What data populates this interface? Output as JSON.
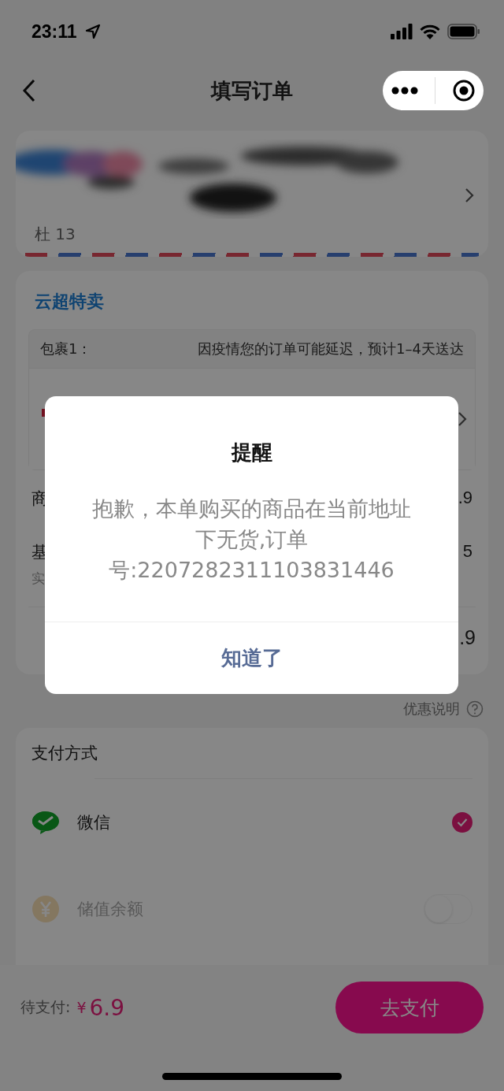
{
  "status_bar": {
    "time": "23:11"
  },
  "nav": {
    "title": "填写订单"
  },
  "address": {
    "name_line": "杜 13"
  },
  "store": {
    "name": "云超特卖",
    "package_label": "包裹1：",
    "package_note": "因疫情您的订单可能延迟，预计1–4天送达",
    "rows": [
      {
        "label": "商",
        "value": ".9"
      },
      {
        "label": "基",
        "sub": "实",
        "value": "5"
      }
    ],
    "total": ".9"
  },
  "discount_note": "优惠说明",
  "payment": {
    "title": "支付方式",
    "methods": [
      {
        "name": "微信",
        "kind": "radio",
        "selected": true
      },
      {
        "name": "储值余额",
        "kind": "toggle",
        "on": false,
        "disabled": true
      }
    ]
  },
  "footer": {
    "label": "待支付:",
    "currency": "¥",
    "amount": "6.9",
    "button": "去支付"
  },
  "dialog": {
    "title": "提醒",
    "message": "抱歉，本单购买的商品在当前地址下无货,订单号:2207282311103831446",
    "button": "知道了"
  }
}
